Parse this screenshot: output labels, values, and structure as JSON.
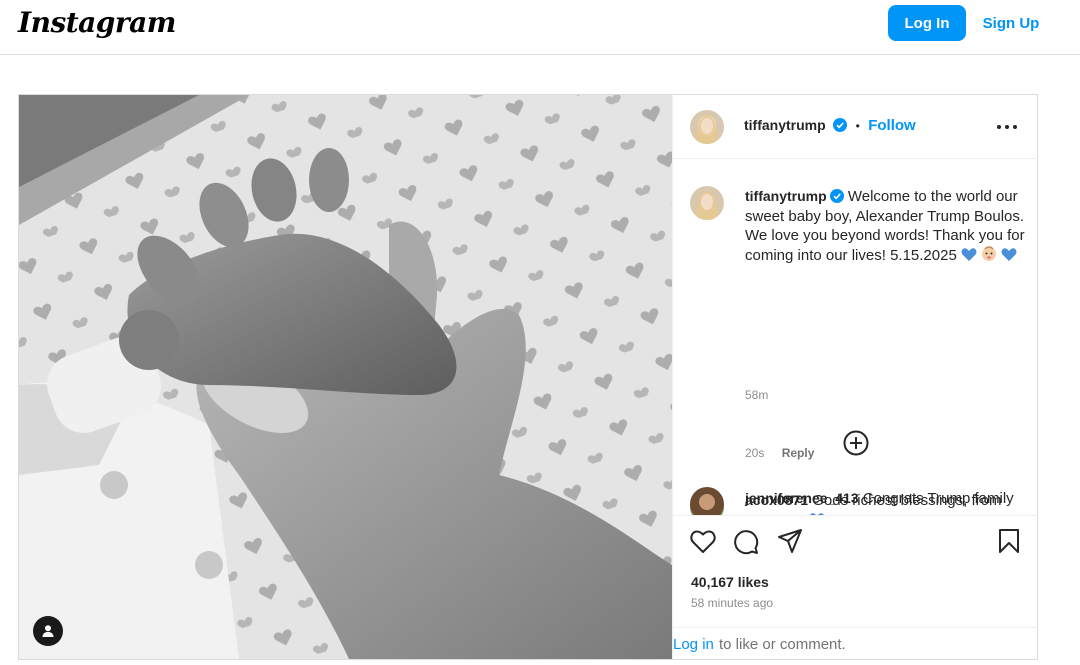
{
  "header": {
    "logo_text": "Instagram",
    "login_label": "Log In",
    "signup_label": "Sign Up"
  },
  "post": {
    "author": "tiffanytrump",
    "verified": true,
    "separator": "•",
    "follow_label": "Follow",
    "caption": "Welcome to the world our sweet baby boy, Alexander Trump Boulos. We love you beyond words! Thank you for coming into our lives! 5.15.2025",
    "caption_emojis": [
      "blue-heart",
      "baby",
      "blue-heart"
    ],
    "caption_age": "58m",
    "load_more_icon": "plus-circle-icon",
    "comments": [
      {
        "user": "acox0871",
        "text": "Gods richest blessings, from Rome,Ga",
        "emoji": "blue-heart",
        "age": "20s",
        "reply_label": "Reply"
      },
      {
        "user": "jenniferenee_413",
        "text": "Congrats Trump family",
        "age": "",
        "reply_label": ""
      }
    ],
    "likes": "40,167 likes",
    "posted_ago": "58 minutes ago",
    "login_link": "Log in",
    "login_suffix": "to like or comment."
  },
  "colors": {
    "accent": "#0095f6",
    "heart_blue": "#4a90d9",
    "border": "#dbdbdb"
  },
  "icons": [
    "heart-icon",
    "comment-icon",
    "share-icon",
    "bookmark-icon",
    "more-icon",
    "verified-badge-icon",
    "user-tag-icon"
  ]
}
